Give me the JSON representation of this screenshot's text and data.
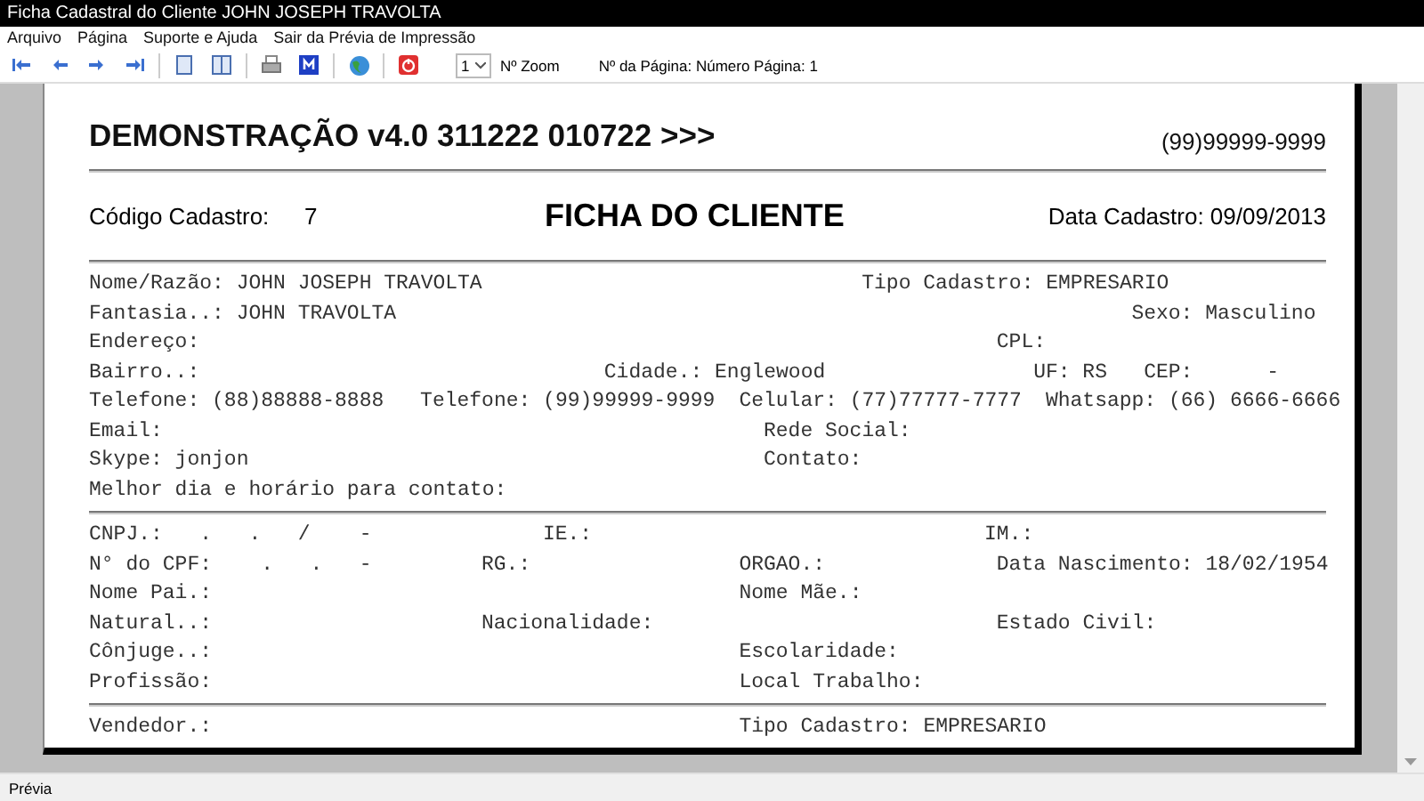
{
  "window": {
    "title": "Ficha Cadastral do Cliente JOHN JOSEPH TRAVOLTA"
  },
  "menu": [
    "Arquivo",
    "Página",
    "Suporte e Ajuda",
    "Sair da Prévia de Impressão"
  ],
  "toolbar": {
    "zoom_select": "1",
    "zoom_label": "Nº Zoom",
    "page_info": "Nº da Página: Número Página: 1"
  },
  "report": {
    "title": "DEMONSTRAÇÃO v4.0 311222 010722 >>>",
    "phone": "(99)99999-9999",
    "code_label": "Código Cadastro:",
    "code_value": "7",
    "heading": "FICHA DO CLIENTE",
    "date": "Data Cadastro: 09/09/2013",
    "sections": [
      {
        "rows": [
          {
            "fields": [
              "Nome/Razão: JOHN JOSEPH TRAVOLTA",
              "Tipo Cadastro: EMPRESARIO"
            ]
          },
          {
            "fields": [
              "Fantasia..: JOHN TRAVOLTA",
              "Sexo: Masculino"
            ]
          },
          {
            "fields": [
              "Endereço:",
              "CPL:"
            ]
          },
          {
            "fields": [
              "Bairro..:",
              "Cidade.: Englewood",
              "UF: RS",
              "CEP:      -"
            ]
          },
          {
            "fields": [
              "Telefone: (88)88888-8888",
              "Telefone: (99)99999-9999",
              "Celular: (77)77777-7777",
              "Whatsapp: (66) 6666-6666"
            ]
          },
          {
            "fields": [
              "Email:",
              "Rede Social:"
            ]
          },
          {
            "fields": [
              "Skype: jonjon",
              "Contato:"
            ]
          },
          {
            "fields": [
              "Melhor dia e horário para contato:"
            ]
          }
        ]
      },
      {
        "rows": [
          {
            "fields": [
              "CNPJ.:   .   .   /    -",
              "IE.:",
              "IM.:"
            ]
          },
          {
            "fields": [
              "N° do CPF:    .   .   -",
              "RG.:",
              "ORGAO.:",
              "Data Nascimento: 18/02/1954"
            ]
          },
          {
            "fields": [
              "Nome Pai.:",
              "Nome Mãe.:"
            ]
          },
          {
            "fields": [
              "Natural..:",
              "Nacionalidade:",
              "Estado Civil:"
            ]
          },
          {
            "fields": [
              "Cônjuge..:",
              "Escolaridade:"
            ]
          },
          {
            "fields": [
              "Profissão:",
              "Local Trabalho:"
            ]
          }
        ]
      },
      {
        "rows": [
          {
            "fields": [
              "Vendedor.:",
              "Tipo Cadastro: EMPRESARIO"
            ]
          }
        ]
      }
    ]
  },
  "status_bar": "Prévia"
}
